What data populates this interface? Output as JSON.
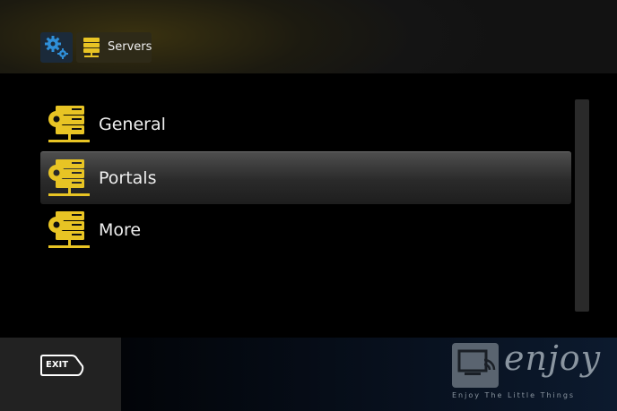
{
  "header": {
    "settings_icon": "gears-icon",
    "breadcrumb_label": "Servers",
    "breadcrumb_icon": "server-icon"
  },
  "menu": {
    "items": [
      {
        "label": "General",
        "icon": "server-gear-icon",
        "selected": false
      },
      {
        "label": "Portals",
        "icon": "server-gear-icon",
        "selected": true
      },
      {
        "label": "More",
        "icon": "server-gear-icon",
        "selected": false
      }
    ]
  },
  "footer": {
    "exit_label": "EXIT",
    "brand": "enjoy",
    "tagline": "Enjoy The Little Things"
  },
  "colors": {
    "accent_yellow": "#e8c424",
    "settings_blue": "#2f8fd8"
  }
}
